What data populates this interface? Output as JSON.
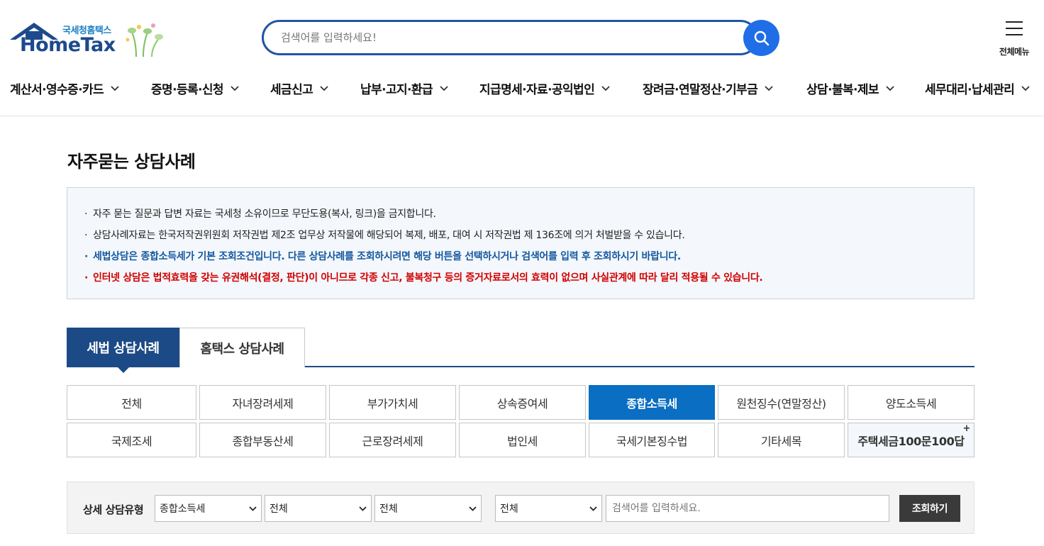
{
  "header": {
    "logo_sub": "국세청홈택스",
    "logo_main": "HomeTax",
    "search_placeholder": "검색어를 입력하세요!",
    "all_menu_label": "전체메뉴"
  },
  "gnb": [
    {
      "label": "계산서·영수증·카드"
    },
    {
      "label": "증명·등록·신청"
    },
    {
      "label": "세금신고"
    },
    {
      "label": "납부·고지·환급"
    },
    {
      "label": "지급명세·자료·공익법인"
    },
    {
      "label": "장려금·연말정산·기부금"
    },
    {
      "label": "상담·불복·제보"
    },
    {
      "label": "세무대리·납세관리"
    }
  ],
  "page_title": "자주묻는 상담사례",
  "notice": [
    {
      "text": "자주 묻는 질문과 답변 자료는 국세청 소유이므로 무단도용(복사, 링크)을 금지합니다.",
      "style": "gray"
    },
    {
      "text": "상담사례자료는 한국저작권위원회 저작권법 제2조 업무상 저작물에 해당되어 복제, 배포, 대여 시 저작권법 제 136조에 의거 처벌받을 수 있습니다.",
      "style": "gray"
    },
    {
      "text": "세법상담은 종합소득세가 기본 조회조건입니다. 다른 상담사례를 조회하시려면 해당 버튼을 선택하시거나 검색어를 입력 후 조회하시기 바랍니다.",
      "style": "blue"
    },
    {
      "text": "인터넷 상담은 법적효력을 갖는 유권해석(결정, 판단)이 아니므로 각종 신고, 불복청구 등의 증거자료로서의 효력이 없으며 사실관계에 따라 달리 적용될 수 있습니다.",
      "style": "red"
    }
  ],
  "tabs": {
    "active": "세법 상담사례",
    "inactive": "홈택스 상담사례"
  },
  "categories": {
    "row1": [
      "전체",
      "자녀장려세제",
      "부가가치세",
      "상속증여세",
      "종합소득세",
      "원천징수(연말정산)",
      "양도소득세"
    ],
    "row2": [
      "국제조세",
      "종합부동산세",
      "근로장려세제",
      "법인세",
      "국세기본징수법",
      "기타세목",
      "주택세금100문100답"
    ],
    "selected": "종합소득세",
    "special_plus": "+"
  },
  "filter": {
    "label": "상세 상담유형",
    "select1": "종합소득세",
    "select2": "전체",
    "select3": "전체",
    "select4": "전체",
    "keyword_placeholder": "검색어를 입력하세요.",
    "button": "조회하기"
  },
  "colors": {
    "brand_navy": "#1c4a86",
    "selected_blue": "#0a6ec2",
    "notice_blue": "#1458a0",
    "notice_red": "#d00000"
  }
}
